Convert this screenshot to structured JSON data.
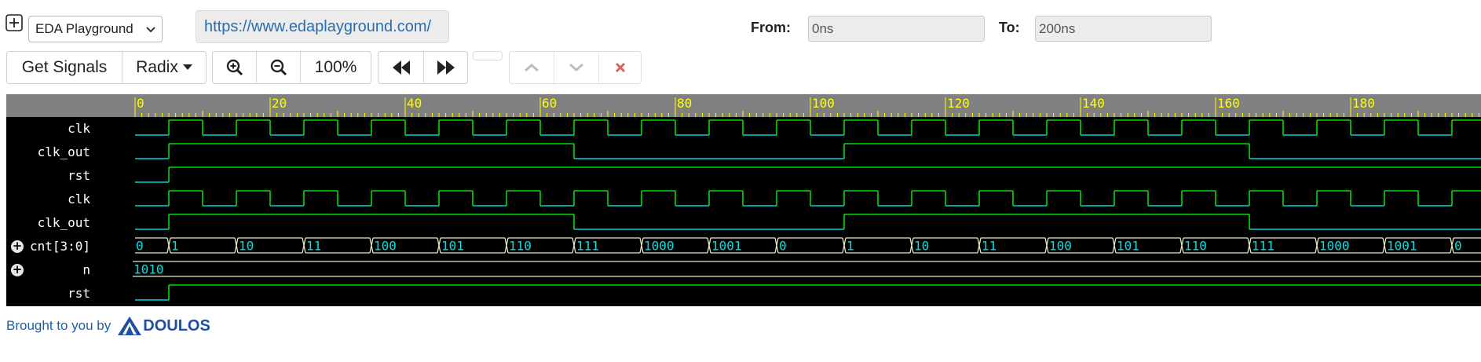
{
  "toolbar": {
    "expand_icon": "plus-square-icon",
    "brand_select": "EDA Playground",
    "url": "https://www.edaplayground.com/",
    "from_label": "From:",
    "from_value": "0ns",
    "to_label": "To:",
    "to_value": "200ns",
    "get_signals": "Get Signals",
    "radix": "Radix",
    "zoom_in_icon": "zoom-in-icon",
    "zoom_out_icon": "zoom-out-icon",
    "zoom_level": "100%",
    "rewind_icon": "rewind-icon",
    "fast_forward_icon": "fast-forward-icon",
    "up_icon": "chevron-up-icon",
    "down_icon": "chevron-down-icon",
    "close_icon": "close-icon"
  },
  "timeline": {
    "start": 0,
    "end": 200,
    "unit": "ns",
    "labels": [
      0,
      20,
      40,
      60,
      80,
      100,
      120,
      140,
      160,
      180
    ]
  },
  "waveform": {
    "colors": {
      "background": "#000000",
      "ruler": "#808080",
      "ruler_text": "#ffff00",
      "high": "#00e000",
      "low": "#00d0e0",
      "bus": "#e8e8c8",
      "value": "#00e0e0"
    },
    "signals": [
      {
        "name": "clk",
        "type": "bit",
        "expandable": false
      },
      {
        "name": "clk_out",
        "type": "bit",
        "expandable": false
      },
      {
        "name": "rst",
        "type": "bit",
        "expandable": false
      },
      {
        "name": "clk",
        "type": "bit",
        "expandable": false
      },
      {
        "name": "clk_out",
        "type": "bit",
        "expandable": false
      },
      {
        "name": "cnt[3:0]",
        "type": "bus",
        "expandable": true,
        "values": [
          "0",
          "1",
          "10",
          "11",
          "100",
          "101",
          "110",
          "111",
          "1000",
          "1001",
          "0",
          "1",
          "10",
          "11",
          "100",
          "101",
          "110",
          "111",
          "1000",
          "1001",
          "0"
        ]
      },
      {
        "name": "n",
        "type": "bus",
        "expandable": true,
        "values": [
          "1010"
        ]
      },
      {
        "name": "rst",
        "type": "bit",
        "expandable": false
      }
    ]
  },
  "footer": {
    "text": "Brought to you by",
    "brand": "DOULOS"
  }
}
